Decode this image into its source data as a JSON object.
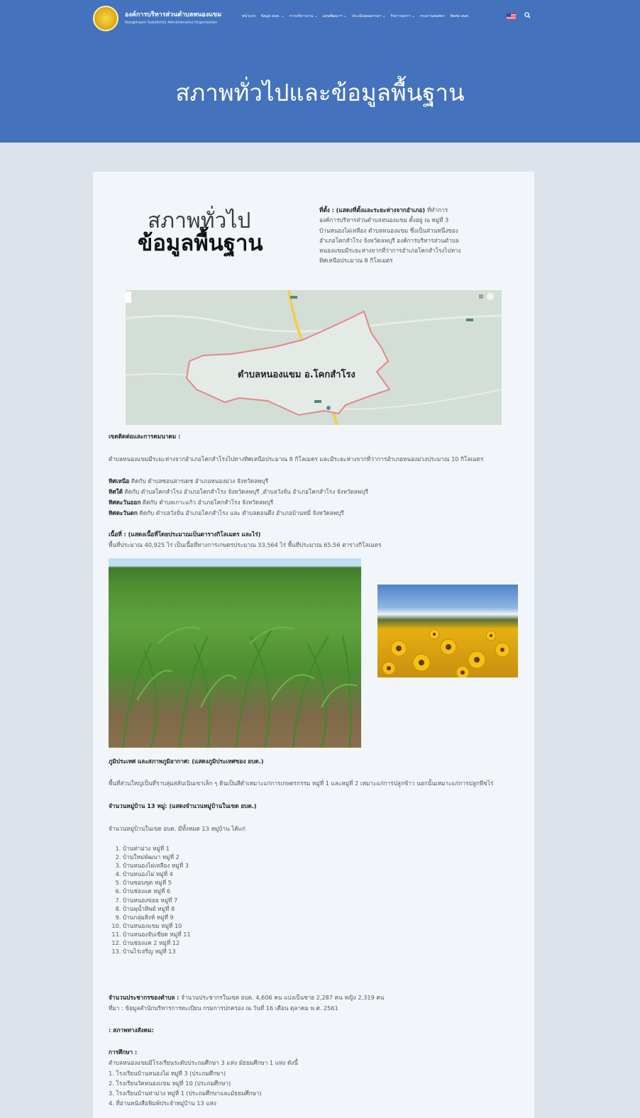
{
  "header": {
    "org_name_th": "องค์การบริหารส่วนตำบลหนองแขม",
    "org_name_en": "Nongkhaem Subdistrict Administrative Organization",
    "nav": [
      "หน้าแรก",
      "ข้อมูล อบต. ⌄",
      "การบริหารงาน ⌄",
      "แผนพัฒนาฯ ⌄",
      "ประเมินคุณธรรมฯ ⌄",
      "กิจการสภาฯ ⌄",
      "กระดานสนทนา",
      "ติดต่อ อบต."
    ],
    "flag_icon": "us-flag-icon",
    "search_icon": "search-icon"
  },
  "hero": {
    "title": "สภาพทั่วไปและข้อมูลพื้นฐาน"
  },
  "intro": {
    "heading_line1": "สภาพทั่วไป",
    "heading_line2": "ข้อมูลพื้นฐาน",
    "location_label": "ที่ตั้ง : (แสดงที่ตั้งและระยะห่างจากอำเภอ)",
    "location_text": "ที่ทำการองค์การบริหารส่วนตำบลหนองแขม ตั้งอยู่ ณ หมู่ที่ 3 บ้านหนองไผ่เหลือง ตำบลหนองแขม ซึ่งเป็นส่วนหนึ่งของอำเภอโคกสำโรง จังหวัดลพบุรี องค์การบริหารส่วนตำบลหนองแขมมีระยะห่างจากที่ว่าการอำเภอโคกสำโรงไปทางทิศเหนือประมาณ 8 กิโลเมตร"
  },
  "map": {
    "label": "ตำบลหนองแขม อ.โคกสำโรง"
  },
  "borders": {
    "heading": "เขตติดต่อและการคมนาคม :",
    "text": "ตำบลหนองแขมมีระยะห่างจากอำเภอโคกสำโรงไปทางทิศเหนือประมาณ 8 กิโลเมตร และมีระยะห่างจากที่ว่าการอำเภอหนองม่วงประมาณ 10 กิโลเมตร",
    "items": [
      {
        "dir": "ทิศเหนือ",
        "text": " ติดกับ ตำบลซอนสารเดช อำเภอหนองม่วง จังหวัดลพบุรี"
      },
      {
        "dir": "ทิศใต้",
        "text": " ติดกับ ตำบลโคกสำโรง อำเภอโคกสำโรง จังหวัดลพบุรี ,ตำบลวังจั่น อำเภอโคกสำโรง จังหวัดลพบุรี"
      },
      {
        "dir": "ทิศตะวันออก",
        "text": " ติดกับ ตำบลเกาะแก้ว อำเภอโคกสำโรง จังหวัดลพบุรี"
      },
      {
        "dir": "ทิศตะวันตก",
        "text": " ติดกับ ตำบลวังจั่น อำเภอโคกสำโรง และ ตำบลดอนดึง อำเภอบ้านหมี่ จังหวัดลพบุรี"
      }
    ]
  },
  "area": {
    "heading": "เนื้อที่ : (แสดงเนื้อที่โดยประมาณเป็นตารางกิโลเมตร และไร่)",
    "text": "พื้นที่ประมาณ 40,925 ไร่ เป็นเนื้อที่ทางการเกษตรประมาณ 33,564 ไร่ พื้นที่ประมาณ 65.56 ตารางกิโลเมตร"
  },
  "terrain": {
    "heading": "ภูมิประเทศ และสภาพภูมิอากาศ: (แสดงภูมิประเทศของ อบต.)",
    "text": "พื้นที่ส่วนใหญ่เป็นที่ราบลุ่มสลับเนินเขาเล็ก ๆ ดินเป็นสีดำเหมาะแก่การเกษตรกรรม หมู่ที่ 1 และหมู่ที่ 2 เหมาะแก่การปลูกข้าว นอกนั้นเหมาะแก่การปลูกพืชไร่"
  },
  "villages": {
    "heading": "จำนวนหมู่บ้าน 13 หมู่: (แสดงจำนวนหมู่บ้านในเขต อบต.)",
    "intro": "จำนวนหมู่บ้านในเขต อบต. มีทั้งหมด 13 หมู่บ้าน ได้แก่",
    "list": [
      "บ้านท่าม่วง หมู่ที่ 1",
      "บ้านใหม่พัฒนา หมู่ที่ 2",
      "บ้านหนองไผ่เหลือง หมู่ที่ 3",
      "บ้านหนองไผ่ หมู่ที่ 4",
      "บ้านซอนขุด หมู่ที่ 5",
      "บ้านช่องแค หมู่ที่ 6",
      "บ้านหนองข่อย หมู่ที่ 7",
      "บ้านพุน้ำทิพย์ หมู่ที่ 8",
      "บ้านกลุ่มสิงห์ หมู่ที่ 9",
      "บ้านหนองแขม หมู่ที่ 10",
      "บ้านหนองจับเขียด หมู่ที่ 11",
      "บ้านช่องแค 2 หมู่ที่ 12",
      "บ้านไร่เจริญ หมู่ที่ 13"
    ]
  },
  "population": {
    "label": "จำนวนประชากรของตำบล :",
    "text": " จำนวนประชากรในเขต อบต. 4,606 คน แบ่งเป็นชาย 2,287 คน หญิง 2,319 คน",
    "source": "ที่มา : ข้อมูลสำนักบริหารการทะเบียน กรมการปกครอง ณ วันที่ 16 เดือน ตุลาคม พ.ศ. 2561"
  },
  "social": {
    "heading": ": สภาพทางสังคม:"
  },
  "education": {
    "heading": "การศึกษา :",
    "intro": "ตำบลหนองแขมมีโรงเรียนระดับประถมศึกษา 3 แห่ง มัธยมศึกษา 1 แห่ง ดังนี้",
    "list": [
      "1. โรงเรียนบ้านหนองไผ่ หมู่ที่ 3 (ประถมศึกษา)",
      "2. โรงเรียนวัดหนองแขม หมู่ที่ 10 (ประถมศึกษา)",
      "3. โรงเรียนบ้านท่าม่วง หมู่ที่ 1 (ประถมศึกษาและมัธยมศึกษา)",
      "4. ที่อ่านหนังสือพิมพ์ประจำหมู่บ้าน 13 แห่ง"
    ]
  },
  "colors": {
    "hero_bg": "#4472bd",
    "page_bg": "#dde3ea",
    "card_bg": "#f2f6fa"
  }
}
